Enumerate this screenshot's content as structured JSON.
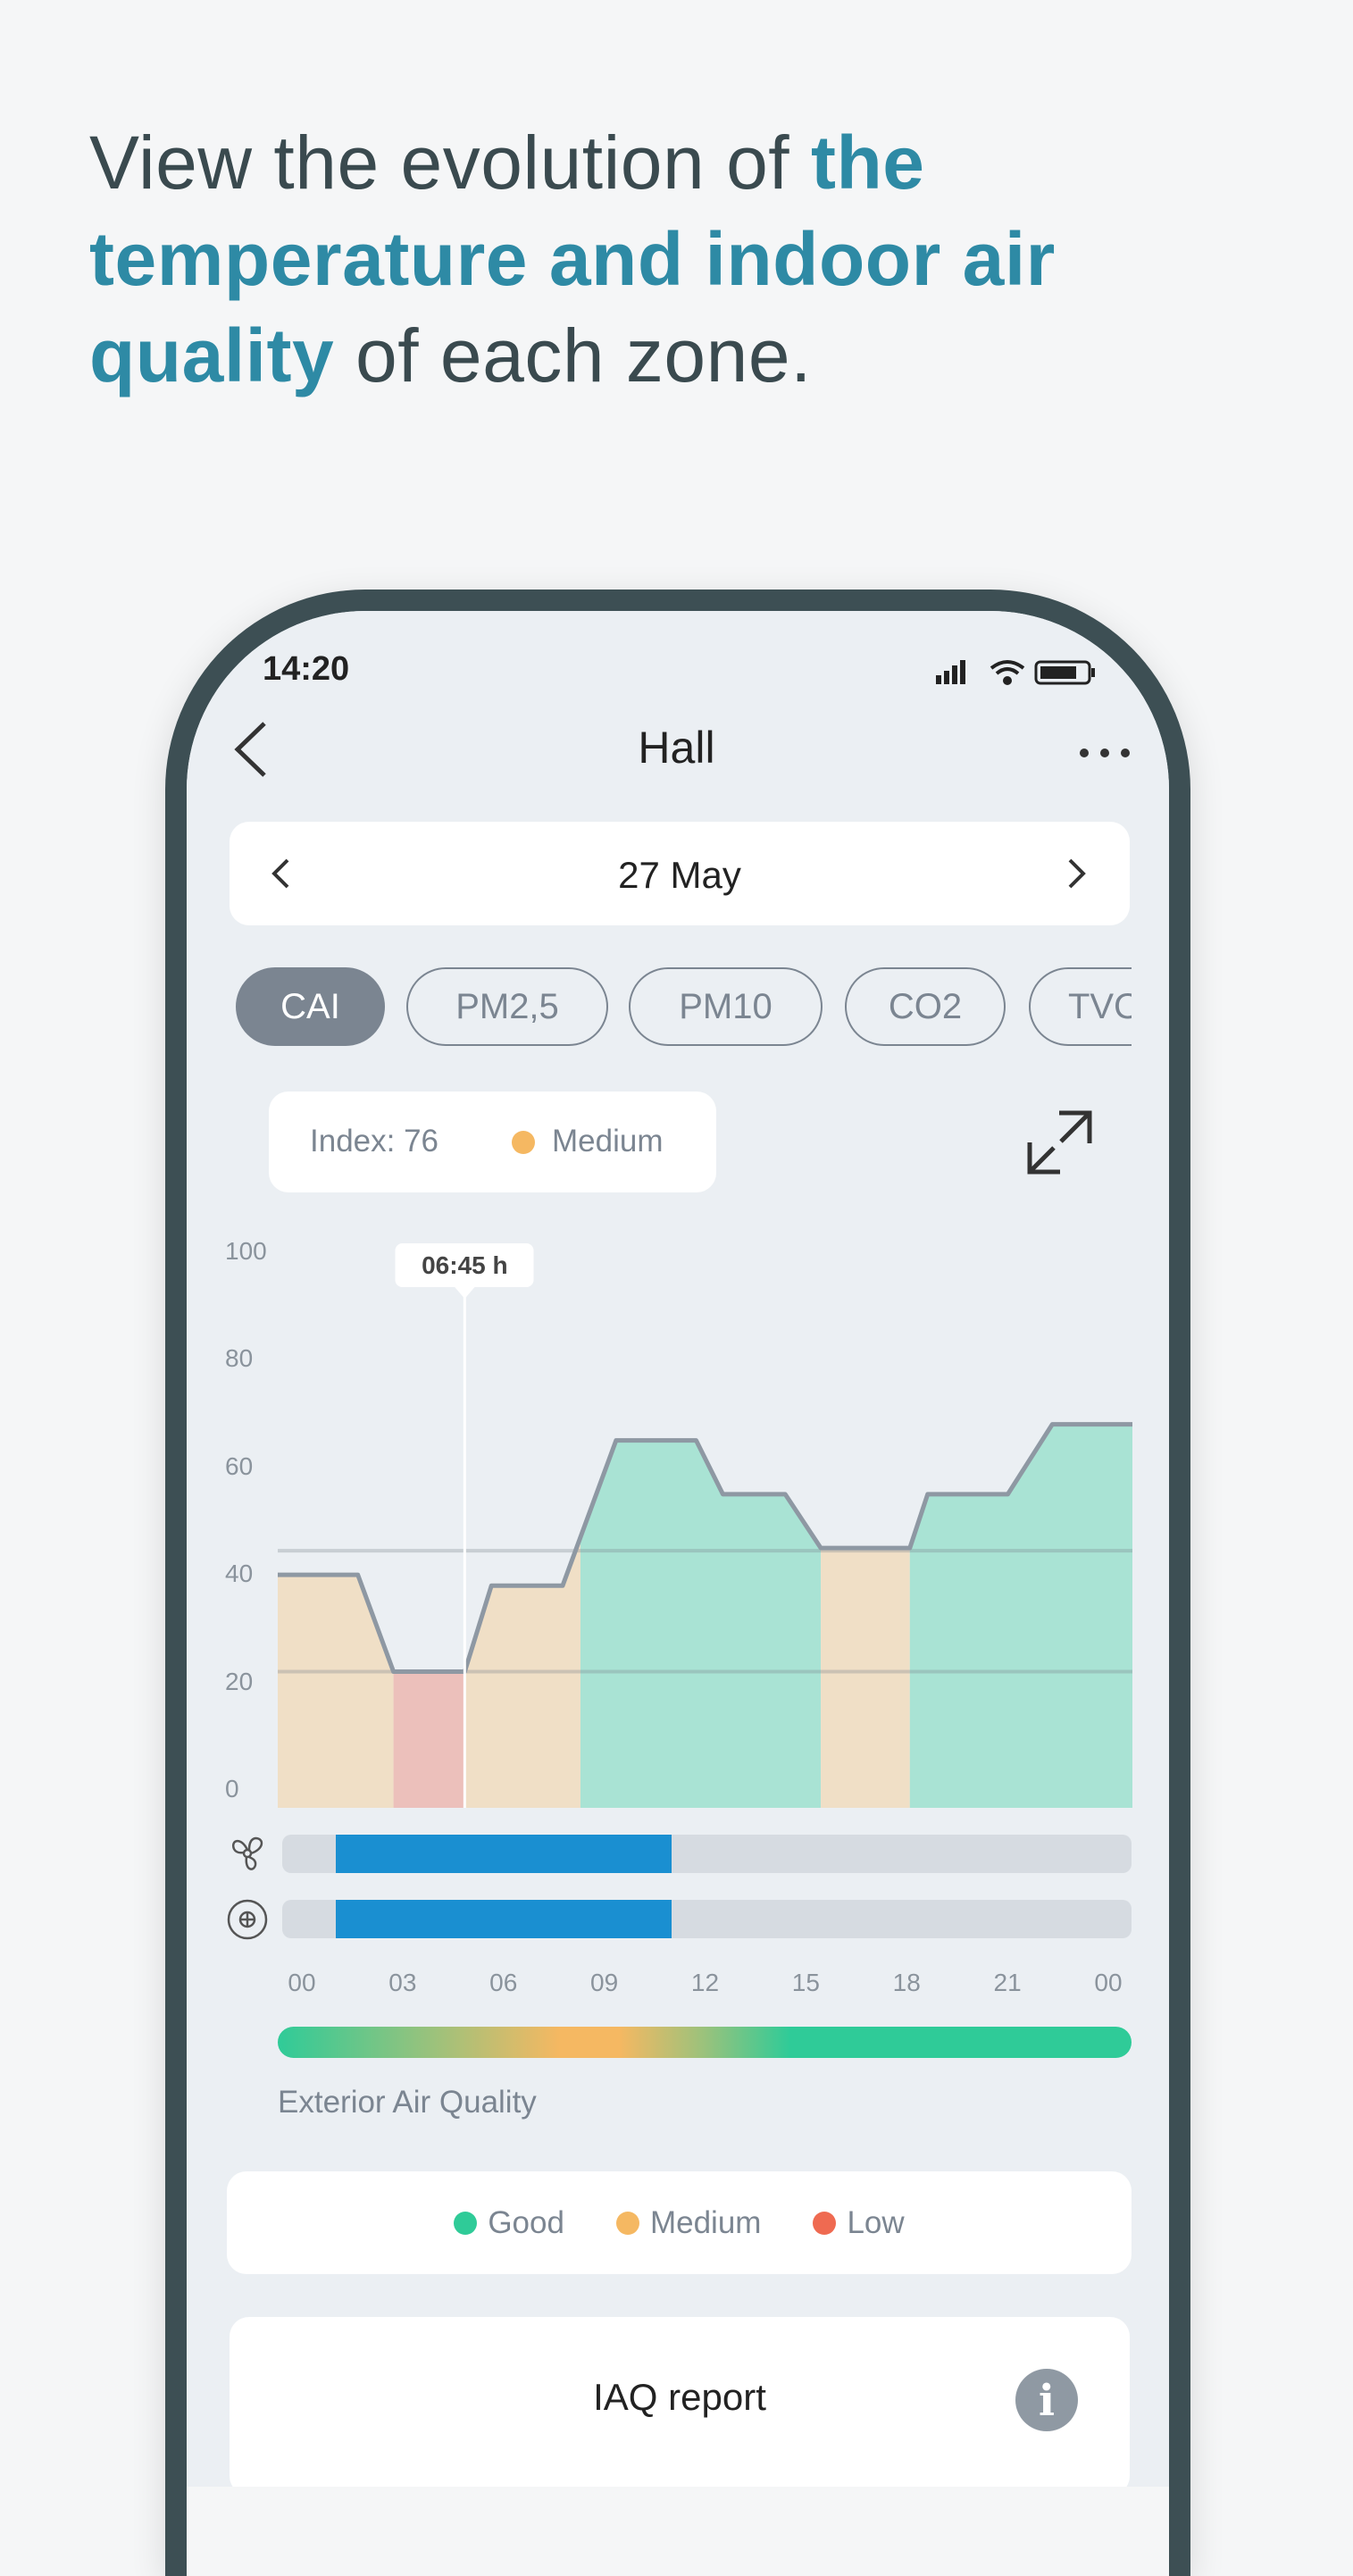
{
  "headline": {
    "part1": "View the evolution of ",
    "highlight": "the temperature and indoor air quality",
    "part2": " of each zone."
  },
  "status_bar": {
    "time": "14:20",
    "icons": [
      "signal-icon",
      "wifi-icon",
      "battery-icon"
    ]
  },
  "header": {
    "title": "Hall",
    "back_icon": "chevron-left-icon",
    "more_icon": "more-dots-icon"
  },
  "date_picker": {
    "date": "27 May"
  },
  "tabs": [
    {
      "label": "CAI",
      "active": true
    },
    {
      "label": "PM2,5",
      "active": false
    },
    {
      "label": "PM10",
      "active": false
    },
    {
      "label": "CO2",
      "active": false
    },
    {
      "label": "TVOC",
      "active": false
    }
  ],
  "index_card": {
    "index_label": "Index: 76",
    "status": "Medium",
    "status_color": "#f5b862"
  },
  "colors": {
    "good": "#2fcb98",
    "medium": "#f5b862",
    "low": "#ef6a51",
    "good_fill": "#a9e3d4",
    "medium_fill": "#f0dfc6",
    "low_fill": "#ecc0bb",
    "bar": "#1a8fd1"
  },
  "chart_data": {
    "type": "area",
    "x_unit": "hour",
    "ylim": [
      0,
      100
    ],
    "xlim": [
      0,
      24
    ],
    "y_ticks": [
      "100",
      "80",
      "60",
      "40",
      "20",
      "0"
    ],
    "x_ticks": [
      "00",
      "03",
      "06",
      "09",
      "12",
      "15",
      "18",
      "21",
      "00"
    ],
    "thresholds": [
      23,
      45.5
    ],
    "series": [
      {
        "points": [
          [
            0,
            41
          ],
          [
            2.25,
            41
          ],
          [
            3.25,
            23
          ],
          [
            5.25,
            23
          ],
          [
            6,
            39
          ],
          [
            8,
            39
          ],
          [
            9.5,
            66
          ],
          [
            11.75,
            66
          ],
          [
            12.5,
            56
          ],
          [
            14.25,
            56
          ],
          [
            15.25,
            46
          ],
          [
            17.75,
            46
          ],
          [
            18.25,
            56
          ],
          [
            20.5,
            56
          ],
          [
            21.75,
            69
          ],
          [
            24,
            69
          ]
        ]
      }
    ],
    "bands": [
      {
        "from": 0,
        "to": 3.25,
        "level": "medium"
      },
      {
        "from": 3.25,
        "to": 5.25,
        "level": "low"
      },
      {
        "from": 5.25,
        "to": 8.5,
        "level": "medium"
      },
      {
        "from": 8.5,
        "to": 15.25,
        "level": "good"
      },
      {
        "from": 15.25,
        "to": 17.75,
        "level": "medium"
      },
      {
        "from": 17.75,
        "to": 24,
        "level": "good"
      }
    ],
    "cursor": {
      "hour": 5.25,
      "label": "06:45 h"
    },
    "activity_bars": [
      {
        "icon": "fan-icon",
        "from": 1,
        "to": 11
      },
      {
        "icon": "air-purifier-icon",
        "from": 1,
        "to": 11
      }
    ]
  },
  "exterior": {
    "label": "Exterior Air Quality"
  },
  "legend": [
    {
      "label": "Good",
      "color": "#2fcb98"
    },
    {
      "label": "Medium",
      "color": "#f5b862"
    },
    {
      "label": "Low",
      "color": "#ef6a51"
    }
  ],
  "report": {
    "label": "IAQ report",
    "icon": "info-icon"
  }
}
